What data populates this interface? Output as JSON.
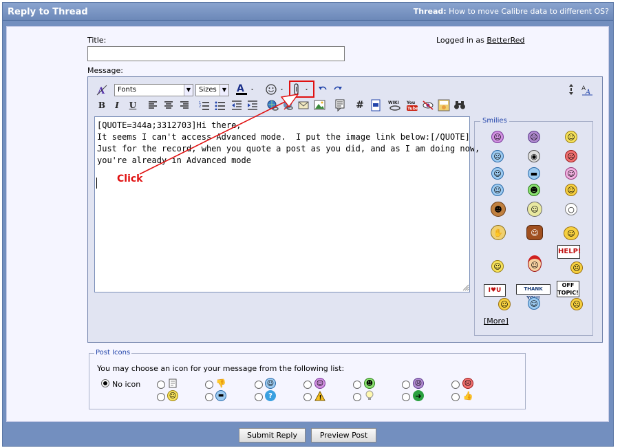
{
  "header": {
    "title": "Reply to Thread",
    "thread_label": "Thread:",
    "thread_name": "How to move Calibre data to different OS?"
  },
  "form": {
    "title_label": "Title:",
    "title_value": "",
    "logged_in_prefix": "Logged in as",
    "username": "BetterRed",
    "message_label": "Message:"
  },
  "toolbar": {
    "font_select": "Fonts",
    "size_select": "Sizes",
    "bold": "B",
    "italic": "I",
    "underline": "U",
    "hash": "#"
  },
  "message": {
    "text": "[QUOTE=344a;3312703]Hi there,\nIt seems I can't access Advanced mode.  I put the image link below:[/QUOTE]\nJust for the record, when you quote a post as you did, and as I am doing now,\nyou're already in Advanced mode"
  },
  "annotation": {
    "text": "Click",
    "color": "#e01010"
  },
  "smilies": {
    "legend": "Smilies",
    "more": "[More]",
    "signs": {
      "help": "HELP!",
      "love_u": "I♥U",
      "thank_you": "THANK YOU!",
      "off_topic": "OFF TOPIC!"
    }
  },
  "post_icons": {
    "legend": "Post Icons",
    "description": "You may choose an icon for your message from the following list:",
    "no_icon_label": "No icon",
    "selected": "no-icon"
  },
  "buttons": {
    "submit": "Submit Reply",
    "preview": "Preview Post"
  },
  "colors": {
    "header_bg": "#738fbf",
    "panel_bg": "#f5f5ff",
    "editor_bg": "#e1e4f2",
    "accent_red": "#e01010",
    "link_blue": "#2244aa"
  }
}
